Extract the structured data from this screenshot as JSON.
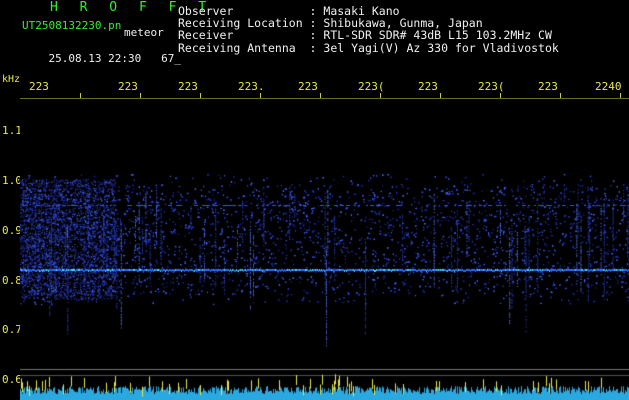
{
  "header": {
    "app_title": "H R O F F T",
    "file_name": "UT2508132230.pn",
    "file_tag": "meteor",
    "datetime": "25.08.13 22:30",
    "count": "67_"
  },
  "info": [
    {
      "label": "Observer",
      "value": "Masaki Kano"
    },
    {
      "label": "Receiving Location",
      "value": "Shibukawa, Gunma, Japan"
    },
    {
      "label": "Receiver",
      "value": "RTL-SDR SDR# 43dB L15 103.2MHz CW"
    },
    {
      "label": "Receiving Antenna",
      "value": "3el Yagi(V) Az 330 for Vladivostok"
    }
  ],
  "axis": {
    "y_unit": "kHz",
    "time_ticks": [
      "223",
      "223",
      "223",
      "223.",
      "223",
      "223(",
      "223",
      "223(",
      "223",
      "2240"
    ],
    "freq_ticks": [
      "1.1",
      "1.0",
      "0.9",
      "0.8",
      "0.7",
      "0.6"
    ]
  },
  "colors": {
    "title_green": "#33ee33",
    "label_yellow": "#e8e84a",
    "signal_blue": "#3355ff",
    "signal_cyan": "#44ddee",
    "noise_floor": "#2aa9e0"
  }
}
